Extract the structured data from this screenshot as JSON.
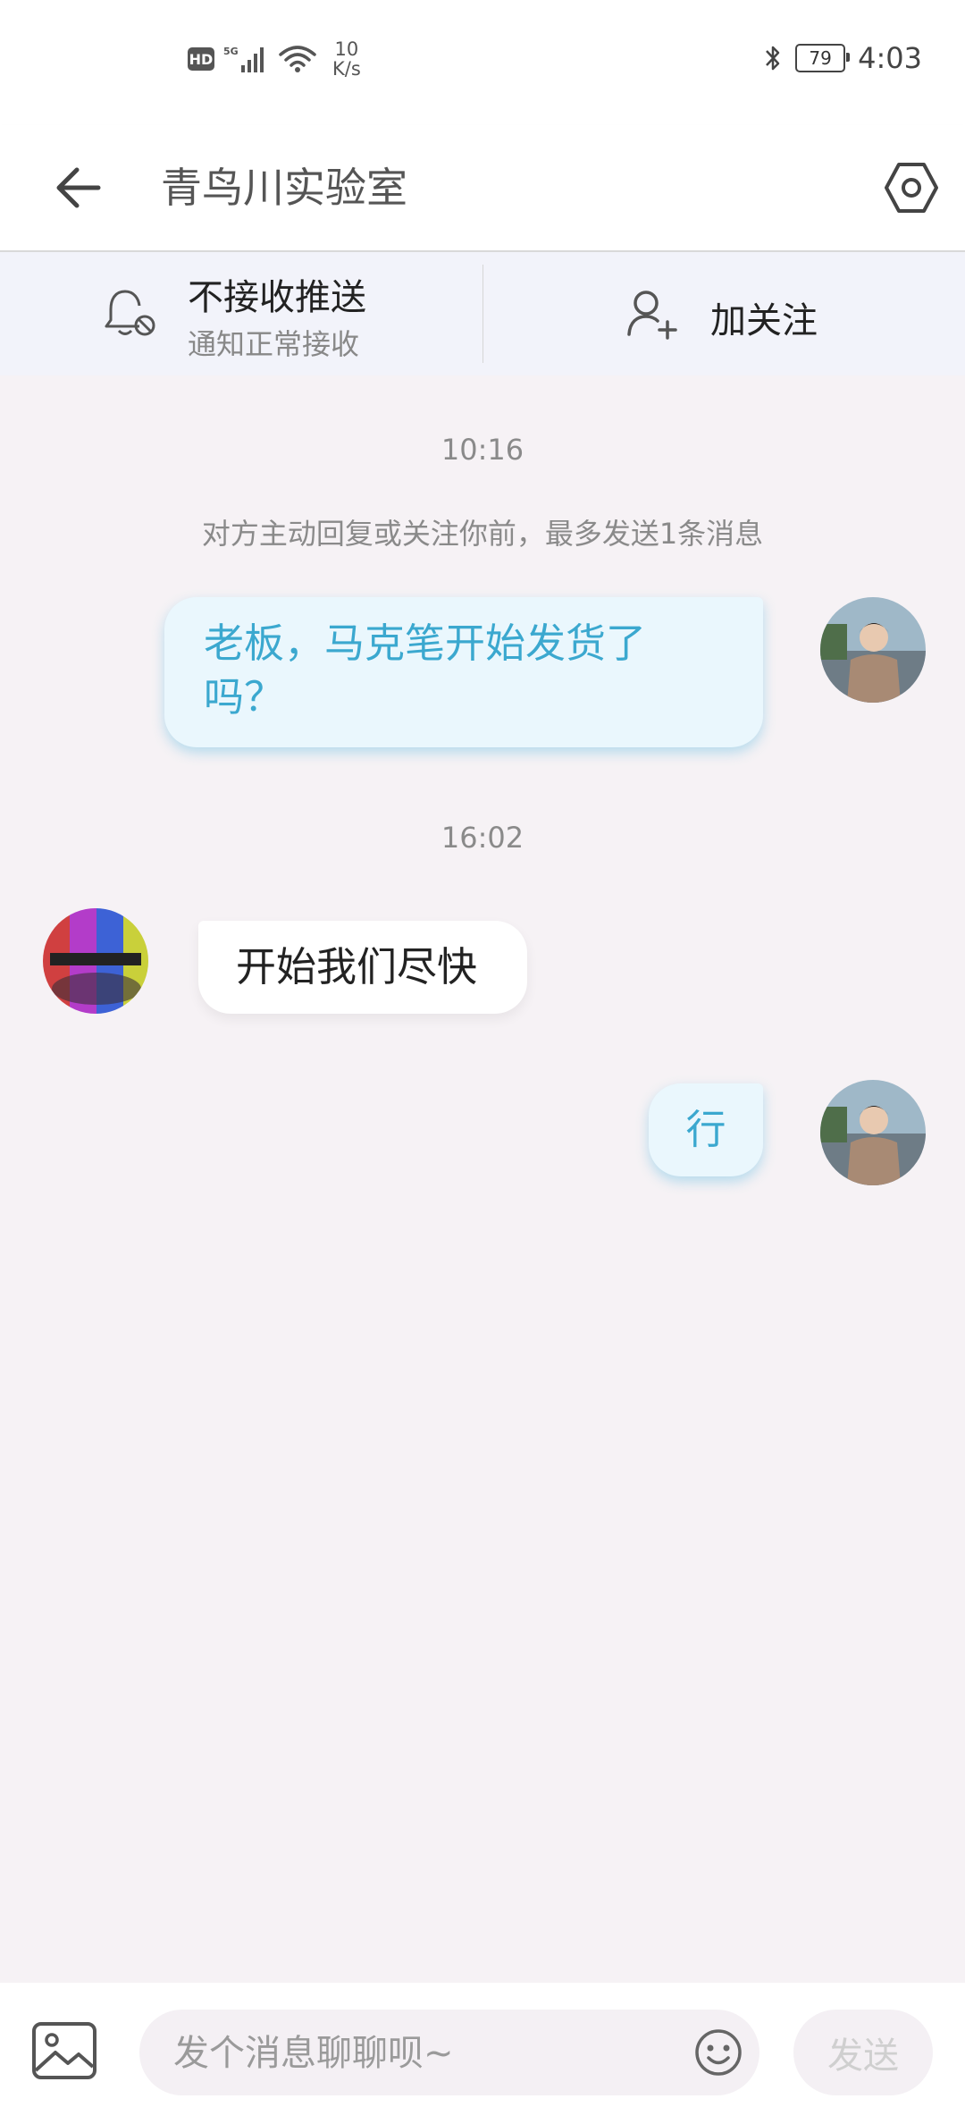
{
  "status_bar": {
    "hd_label": "HD",
    "net_speed_value": "10",
    "net_speed_unit": "K/s",
    "battery_level": "79",
    "time": "4:03"
  },
  "header": {
    "title": "青鸟川实验室",
    "back_icon": "arrow-left-icon",
    "settings_icon": "hexagon-settings-icon"
  },
  "action_bar": {
    "push_title": "不接收推送",
    "push_subtitle": "通知正常接收",
    "follow_label": "加关注"
  },
  "chat": {
    "timestamp_1": "10:16",
    "notice": "对方主动回复或关注你前，最多发送1条消息",
    "messages": [
      {
        "direction": "out",
        "text_line1": "老板，马克笔开始发货了",
        "text_line2": "吗？"
      },
      {
        "direction": "in",
        "text": "开始我们尽快"
      },
      {
        "direction": "out",
        "text": "行"
      }
    ],
    "timestamp_2": "16:02"
  },
  "input_bar": {
    "placeholder": "发个消息聊聊呗~",
    "value": "",
    "send_label": "发送"
  },
  "colors": {
    "outgoing_bubble_bg": "#eaf7fd",
    "outgoing_text": "#3ba8cf",
    "chat_bg": "#f6f2f5",
    "action_bar_bg": "#f2f3fa"
  }
}
